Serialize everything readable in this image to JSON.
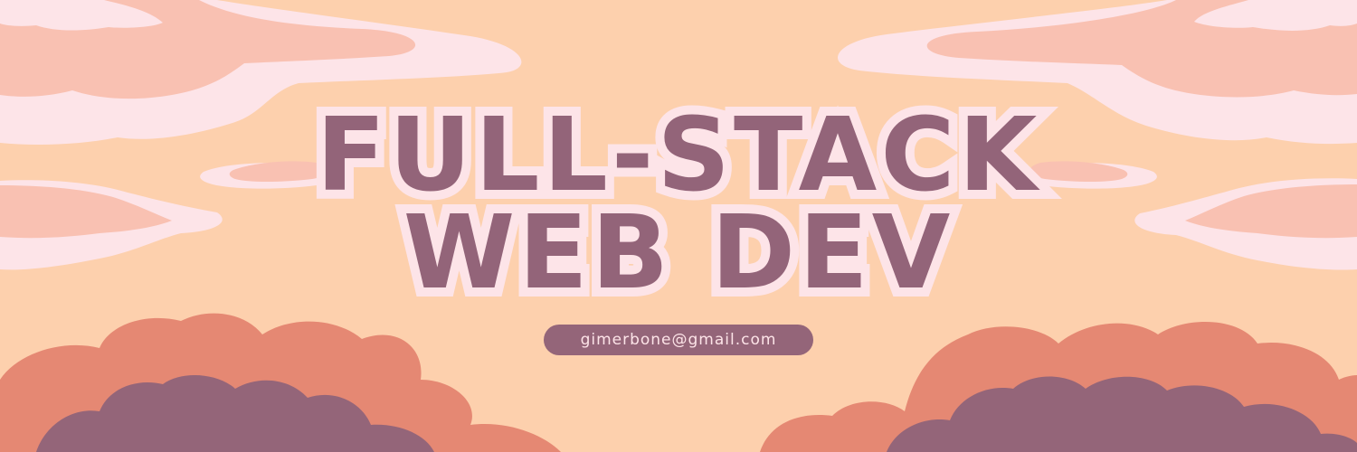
{
  "banner": {
    "headline_line1": "FULL-STACK",
    "headline_line2": "WEB DEV",
    "email": "gimerbone@gmail.com"
  },
  "colors": {
    "background": "#fdd0ad",
    "text": "#936479",
    "text_outline": "#fde4e8",
    "cloud_light": "#fde4e8",
    "cloud_pink": "#f9c1b2",
    "cloud_coral": "#e58873",
    "cloud_purple": "#946579"
  }
}
